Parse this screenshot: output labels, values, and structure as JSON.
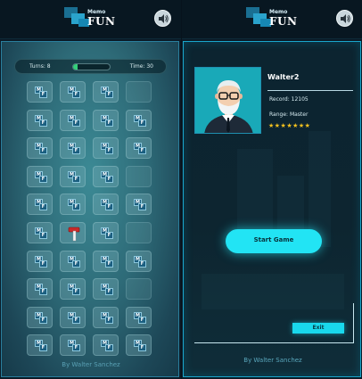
{
  "app": {
    "logo_small": "Memo",
    "logo_big": "FUN",
    "sound_icon": "speaker-icon"
  },
  "colors": {
    "accent": "#22e4f4",
    "progress_fill": "#34d07a",
    "stars": "#f4c11e",
    "card_tile": "#1b5f80"
  },
  "game": {
    "turns_text": "Turns: 8",
    "time_text": "Time: 30",
    "progress": 0.12,
    "cards": [
      [
        "mf",
        "mf",
        "mf",
        "empty"
      ],
      [
        "mf",
        "mf",
        "mf",
        "mf"
      ],
      [
        "mf",
        "mf",
        "mf",
        "mf"
      ],
      [
        "mf",
        "mf",
        "mf",
        "empty"
      ],
      [
        "mf",
        "mf",
        "mf",
        "mf"
      ],
      [
        "mf",
        "hammer",
        "mf",
        "empty"
      ],
      [
        "mf",
        "mf",
        "mf",
        "mf"
      ],
      [
        "mf",
        "mf",
        "mf",
        "empty"
      ],
      [
        "mf",
        "mf",
        "mf",
        "mf"
      ],
      [
        "mf",
        "mf",
        "mf",
        "mf"
      ]
    ],
    "card_m": "M",
    "card_f": "F",
    "byline": "By Walter Sanchez"
  },
  "profile": {
    "player_name": "Walter2",
    "record_text": "Record: 12105",
    "range_text": "Range: Master",
    "stars": "★★★★★★★",
    "start_label": "Start Game",
    "exit_label": "Exit",
    "byline": "By Walter Sanchez"
  }
}
